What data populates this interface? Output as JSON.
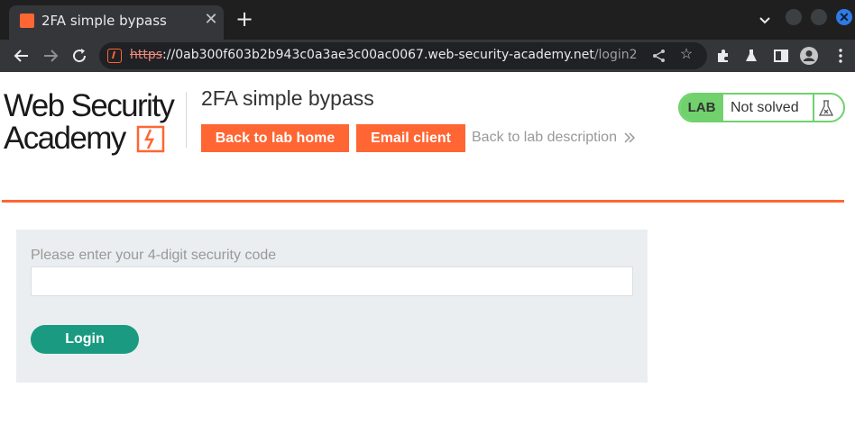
{
  "browser": {
    "tab": {
      "title": "2FA simple bypass",
      "favicon": "portswigger-favicon"
    },
    "new_tab_icon": "plus-icon",
    "url": {
      "scheme": "https",
      "separator": "://",
      "host": "0ab300f603b2b943c0a3ae3c00ac0067.web-security-academy.net",
      "path": "/login2"
    },
    "colors": {
      "tabbar": "#1f1f1f",
      "toolbar": "#35363a",
      "insecure_scheme": "#f28b82"
    }
  },
  "header": {
    "logo": {
      "line1": "Web Security",
      "line2": "Academy"
    },
    "lab_title": "2FA simple bypass",
    "back_to_lab_home": "Back to lab home",
    "email_client": "Email client",
    "back_to_description": "Back to lab description",
    "lab_badge": {
      "tag": "LAB",
      "status": "Not solved",
      "icon": "flask-icon"
    }
  },
  "login_form": {
    "label": "Please enter your 4-digit security code",
    "input_value": "",
    "submit_label": "Login"
  },
  "colors": {
    "accent": "#ff6633",
    "lab_green": "#70d16d",
    "login_button": "#1a9b81",
    "panel": "#eaeef0"
  }
}
